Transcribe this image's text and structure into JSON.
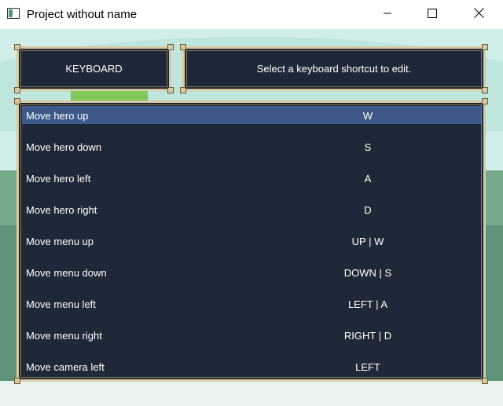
{
  "window": {
    "title": "Project without name",
    "icons": {
      "app": "app-window-icon",
      "minimize": "minimize-icon",
      "maximize": "maximize-icon",
      "close": "close-icon"
    }
  },
  "header": {
    "category": "KEYBOARD",
    "message": "Select a keyboard shortcut to edit."
  },
  "shortcuts": [
    {
      "label": "Move hero up",
      "keys": "W",
      "selected": true
    },
    {
      "label": "Move hero down",
      "keys": "S"
    },
    {
      "label": "Move hero left",
      "keys": "A"
    },
    {
      "label": "Move hero right",
      "keys": "D"
    },
    {
      "label": "Move menu up",
      "keys": "UP | W"
    },
    {
      "label": "Move menu down",
      "keys": "DOWN | S"
    },
    {
      "label": "Move menu left",
      "keys": "LEFT | A"
    },
    {
      "label": "Move menu right",
      "keys": "RIGHT | D"
    },
    {
      "label": "Move camera left",
      "keys": "LEFT"
    }
  ],
  "colors": {
    "panel_bg": "#1f2838",
    "panel_border": "#d9c9a3",
    "selection": "#3d5a8a",
    "text": "#ffffff"
  }
}
